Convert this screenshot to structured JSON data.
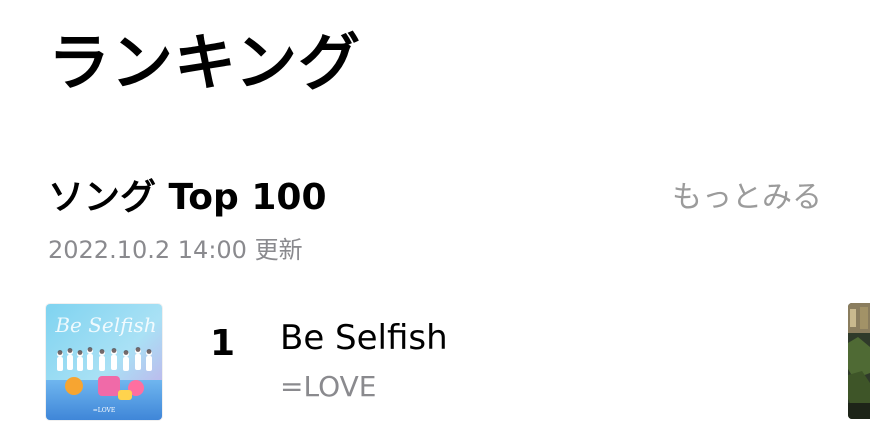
{
  "header": {
    "title": "ランキング"
  },
  "section": {
    "title": "ソング Top 100",
    "more_label": "もっとみる",
    "updated": "2022.10.2 14:00 更新"
  },
  "songs": [
    {
      "rank": "1",
      "title": "Be Selfish",
      "artist": "=LOVE",
      "artwork_text": "Be Selfish",
      "artwork_label": "=LOVE"
    }
  ],
  "colors": {
    "text_primary": "#000000",
    "text_secondary": "#8a8a8e",
    "link_muted": "#9b9b9b",
    "background": "#ffffff"
  }
}
